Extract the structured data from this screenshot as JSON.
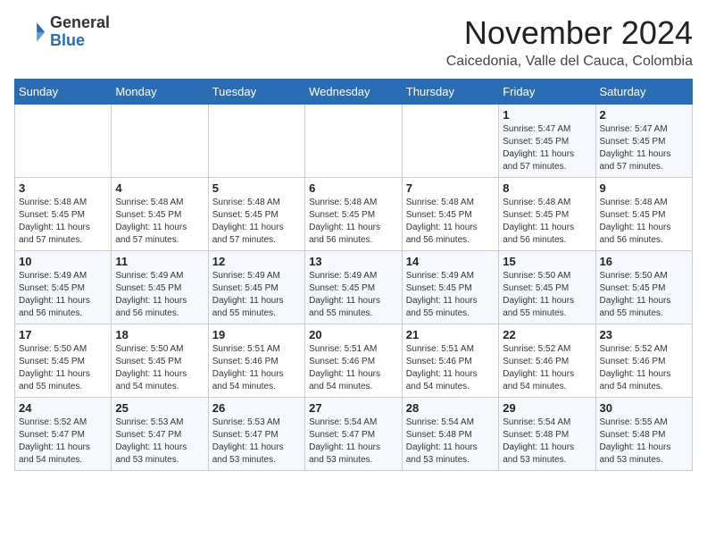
{
  "logo": {
    "general": "General",
    "blue": "Blue"
  },
  "header": {
    "month": "November 2024",
    "location": "Caicedonia, Valle del Cauca, Colombia"
  },
  "weekdays": [
    "Sunday",
    "Monday",
    "Tuesday",
    "Wednesday",
    "Thursday",
    "Friday",
    "Saturday"
  ],
  "weeks": [
    [
      {
        "day": "",
        "info": ""
      },
      {
        "day": "",
        "info": ""
      },
      {
        "day": "",
        "info": ""
      },
      {
        "day": "",
        "info": ""
      },
      {
        "day": "",
        "info": ""
      },
      {
        "day": "1",
        "info": "Sunrise: 5:47 AM\nSunset: 5:45 PM\nDaylight: 11 hours\nand 57 minutes."
      },
      {
        "day": "2",
        "info": "Sunrise: 5:47 AM\nSunset: 5:45 PM\nDaylight: 11 hours\nand 57 minutes."
      }
    ],
    [
      {
        "day": "3",
        "info": "Sunrise: 5:48 AM\nSunset: 5:45 PM\nDaylight: 11 hours\nand 57 minutes."
      },
      {
        "day": "4",
        "info": "Sunrise: 5:48 AM\nSunset: 5:45 PM\nDaylight: 11 hours\nand 57 minutes."
      },
      {
        "day": "5",
        "info": "Sunrise: 5:48 AM\nSunset: 5:45 PM\nDaylight: 11 hours\nand 57 minutes."
      },
      {
        "day": "6",
        "info": "Sunrise: 5:48 AM\nSunset: 5:45 PM\nDaylight: 11 hours\nand 56 minutes."
      },
      {
        "day": "7",
        "info": "Sunrise: 5:48 AM\nSunset: 5:45 PM\nDaylight: 11 hours\nand 56 minutes."
      },
      {
        "day": "8",
        "info": "Sunrise: 5:48 AM\nSunset: 5:45 PM\nDaylight: 11 hours\nand 56 minutes."
      },
      {
        "day": "9",
        "info": "Sunrise: 5:48 AM\nSunset: 5:45 PM\nDaylight: 11 hours\nand 56 minutes."
      }
    ],
    [
      {
        "day": "10",
        "info": "Sunrise: 5:49 AM\nSunset: 5:45 PM\nDaylight: 11 hours\nand 56 minutes."
      },
      {
        "day": "11",
        "info": "Sunrise: 5:49 AM\nSunset: 5:45 PM\nDaylight: 11 hours\nand 56 minutes."
      },
      {
        "day": "12",
        "info": "Sunrise: 5:49 AM\nSunset: 5:45 PM\nDaylight: 11 hours\nand 55 minutes."
      },
      {
        "day": "13",
        "info": "Sunrise: 5:49 AM\nSunset: 5:45 PM\nDaylight: 11 hours\nand 55 minutes."
      },
      {
        "day": "14",
        "info": "Sunrise: 5:49 AM\nSunset: 5:45 PM\nDaylight: 11 hours\nand 55 minutes."
      },
      {
        "day": "15",
        "info": "Sunrise: 5:50 AM\nSunset: 5:45 PM\nDaylight: 11 hours\nand 55 minutes."
      },
      {
        "day": "16",
        "info": "Sunrise: 5:50 AM\nSunset: 5:45 PM\nDaylight: 11 hours\nand 55 minutes."
      }
    ],
    [
      {
        "day": "17",
        "info": "Sunrise: 5:50 AM\nSunset: 5:45 PM\nDaylight: 11 hours\nand 55 minutes."
      },
      {
        "day": "18",
        "info": "Sunrise: 5:50 AM\nSunset: 5:45 PM\nDaylight: 11 hours\nand 54 minutes."
      },
      {
        "day": "19",
        "info": "Sunrise: 5:51 AM\nSunset: 5:46 PM\nDaylight: 11 hours\nand 54 minutes."
      },
      {
        "day": "20",
        "info": "Sunrise: 5:51 AM\nSunset: 5:46 PM\nDaylight: 11 hours\nand 54 minutes."
      },
      {
        "day": "21",
        "info": "Sunrise: 5:51 AM\nSunset: 5:46 PM\nDaylight: 11 hours\nand 54 minutes."
      },
      {
        "day": "22",
        "info": "Sunrise: 5:52 AM\nSunset: 5:46 PM\nDaylight: 11 hours\nand 54 minutes."
      },
      {
        "day": "23",
        "info": "Sunrise: 5:52 AM\nSunset: 5:46 PM\nDaylight: 11 hours\nand 54 minutes."
      }
    ],
    [
      {
        "day": "24",
        "info": "Sunrise: 5:52 AM\nSunset: 5:47 PM\nDaylight: 11 hours\nand 54 minutes."
      },
      {
        "day": "25",
        "info": "Sunrise: 5:53 AM\nSunset: 5:47 PM\nDaylight: 11 hours\nand 53 minutes."
      },
      {
        "day": "26",
        "info": "Sunrise: 5:53 AM\nSunset: 5:47 PM\nDaylight: 11 hours\nand 53 minutes."
      },
      {
        "day": "27",
        "info": "Sunrise: 5:54 AM\nSunset: 5:47 PM\nDaylight: 11 hours\nand 53 minutes."
      },
      {
        "day": "28",
        "info": "Sunrise: 5:54 AM\nSunset: 5:48 PM\nDaylight: 11 hours\nand 53 minutes."
      },
      {
        "day": "29",
        "info": "Sunrise: 5:54 AM\nSunset: 5:48 PM\nDaylight: 11 hours\nand 53 minutes."
      },
      {
        "day": "30",
        "info": "Sunrise: 5:55 AM\nSunset: 5:48 PM\nDaylight: 11 hours\nand 53 minutes."
      }
    ]
  ]
}
